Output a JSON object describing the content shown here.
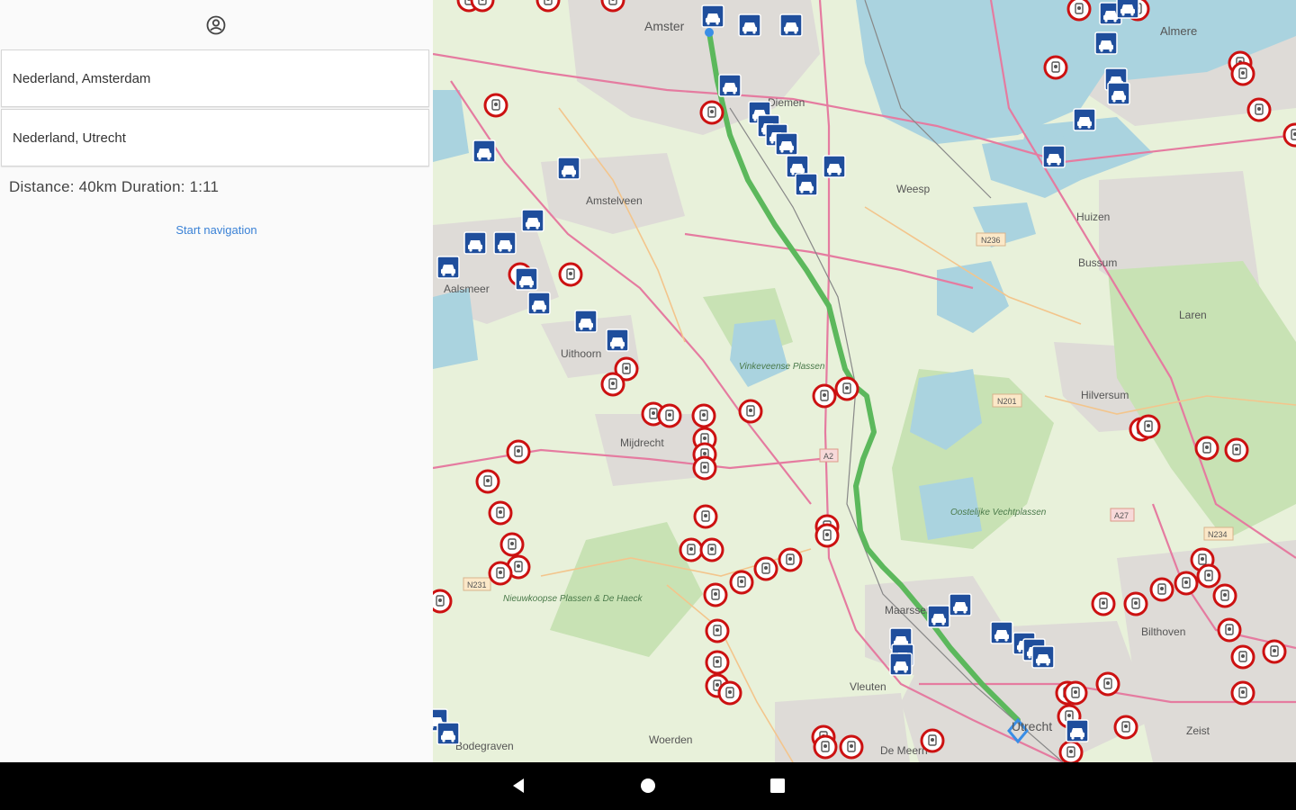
{
  "panel": {
    "profile_icon": "account-circle-icon",
    "from_value": "Nederland, Amsterdam",
    "to_value": "Nederland, Utrecht",
    "route_info": "Distance: 40km Duration: 1:11",
    "start_nav_label": "Start navigation",
    "accent_color": "#3b82d6"
  },
  "map": {
    "route_color": "#5cb85c",
    "endpoint_color": "#3a8ee6",
    "camera_icon": "speed-camera-icon",
    "parking_icon": "car-parking-icon",
    "camera_color": "#cc1111",
    "parking_color": "#1f4e9c",
    "labels": {
      "amsterdam": "Amster",
      "almere": "Almere",
      "diemen": "Diemen",
      "amstelveen": "Amstelveen",
      "weesp": "Weesp",
      "huizen": "Huizen",
      "bussum": "Bussum",
      "laren": "Laren",
      "aalsmeer": "Aalsmeer",
      "uithoorn": "Uithoorn",
      "hilversum": "Hilversum",
      "mijdrecht": "Mijdrecht",
      "vinkeveense": "Vinkeveense Plassen",
      "loosdrechtse": "Oostelijke Vechtplassen",
      "nieuwkoopse": "Nieuwkoopse Plassen & De Haeck",
      "bilthoven": "Bilthoven",
      "maarssen": "Maarssen",
      "vleuten": "Vleuten",
      "woerden": "Woerden",
      "demeern": "De Meern",
      "utrecht": "Utrecht",
      "zeist": "Zeist",
      "bodegraven": "Bodegraven",
      "a2": "A2",
      "a27": "A27",
      "n201": "N201",
      "n236": "N236",
      "n231": "N231",
      "n234": "N234"
    }
  },
  "navbar": {
    "back_icon": "back-triangle-icon",
    "home_icon": "home-circle-icon",
    "recents_icon": "recents-square-icon"
  }
}
